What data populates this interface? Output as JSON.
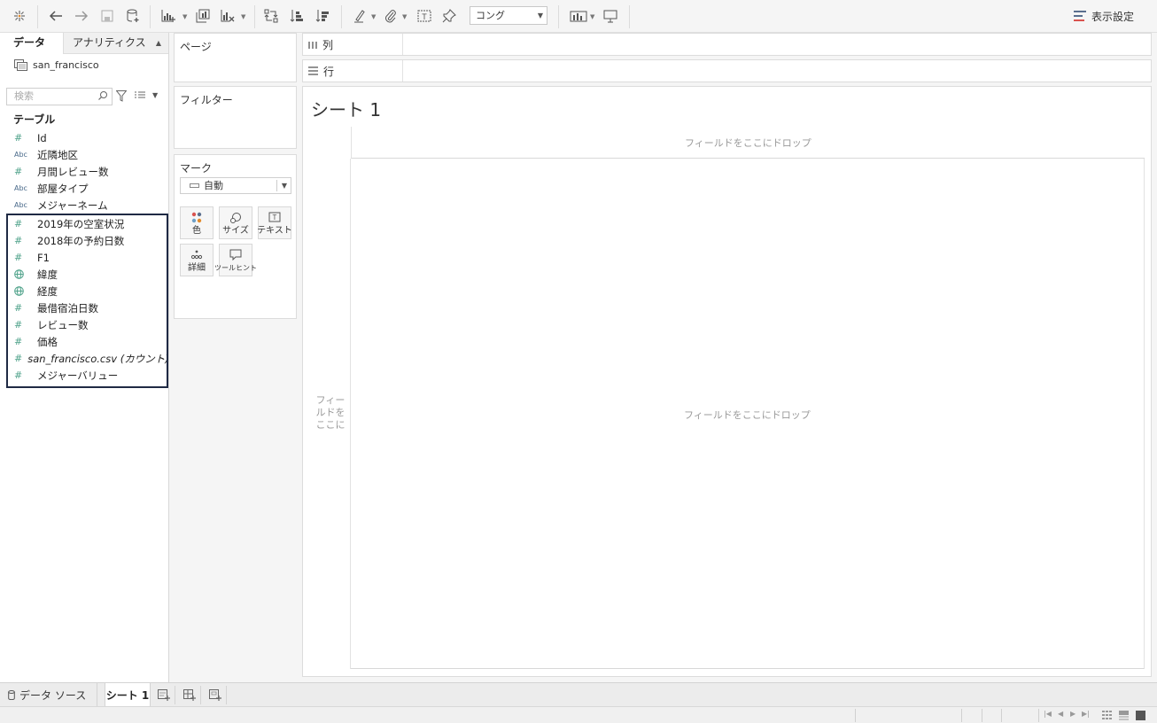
{
  "toolbar": {
    "zoom_value": "コング",
    "display_settings_label": "表示設定",
    "buttons": [
      "tableau-logo-icon",
      "undo-icon",
      "redo-icon",
      "save-icon",
      "new-datasource-icon",
      "new-worksheet-icon",
      "duplicate-sheet-icon",
      "clear-sheet-icon",
      "swap-icon",
      "sort-ascending-icon",
      "sort-descending-icon",
      "highlight-icon",
      "group-icon",
      "label-icon",
      "pin-icon",
      "show-me-icon",
      "presentation-icon"
    ]
  },
  "data_pane": {
    "tab_data": "データ",
    "tab_analytics": "アナリティクス",
    "datasource_name": "san_francisco",
    "search_placeholder": "検索",
    "tables_heading": "テーブル",
    "fields": [
      {
        "type": "hash",
        "type_label": "#",
        "name": "Id"
      },
      {
        "type": "abc",
        "type_label": "Abc",
        "name": "近隣地区"
      },
      {
        "type": "hash",
        "type_label": "#",
        "name": "月間レビュー数"
      },
      {
        "type": "abc",
        "type_label": "Abc",
        "name": "部屋タイプ"
      },
      {
        "type": "abc",
        "type_label": "Abc",
        "name": "メジャーネーム"
      },
      {
        "type": "hash",
        "type_label": "#",
        "name": "2019年の空室状況"
      },
      {
        "type": "hash",
        "type_label": "#",
        "name": "2018年の予約日数"
      },
      {
        "type": "hash",
        "type_label": "#",
        "name": "F1"
      },
      {
        "type": "globe",
        "type_label": "",
        "name": "緯度"
      },
      {
        "type": "globe",
        "type_label": "",
        "name": "経度"
      },
      {
        "type": "hash",
        "type_label": "#",
        "name": "最借宿泊日数"
      },
      {
        "type": "hash",
        "type_label": "#",
        "name": "レビュー数"
      },
      {
        "type": "hash",
        "type_label": "#",
        "name": "価格"
      },
      {
        "type": "hash",
        "type_label": "#",
        "name": "san_francisco.csv (カウント)"
      },
      {
        "type": "hash",
        "type_label": "#",
        "name": "メジャーバリュー"
      }
    ]
  },
  "shelves": {
    "pages_title": "ページ",
    "filters_title": "フィルター",
    "marks_title": "マーク",
    "marks_type": "自動",
    "mark_buttons": {
      "color": "色",
      "size": "サイズ",
      "text": "テキスト",
      "detail": "詳細",
      "tooltip": "ツールヒント"
    },
    "columns_label": "列",
    "rows_label": "行"
  },
  "worksheet": {
    "title": "シート 1",
    "drop_top": "フィールドをここにドロップ",
    "drop_left": "フィールドをここに",
    "drop_center": "フィールドをここにドロップ"
  },
  "bottom_tabs": {
    "datasource_label": "データ ソース",
    "sheet_label": "シート 1"
  }
}
